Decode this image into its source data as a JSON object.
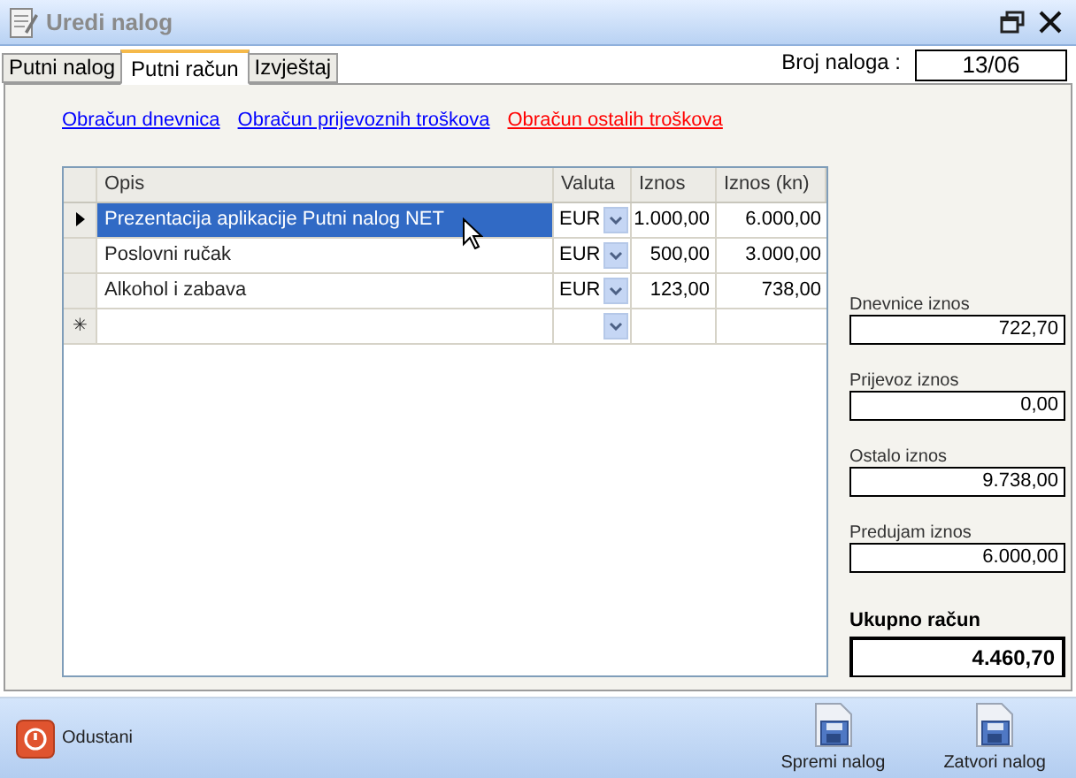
{
  "window": {
    "title": "Uredi nalog"
  },
  "tabs": [
    {
      "label": "Putni nalog",
      "selected": false
    },
    {
      "label": "Putni račun",
      "selected": true
    },
    {
      "label": "Izvještaj",
      "selected": false
    }
  ],
  "order_number": {
    "label": "Broj naloga :",
    "value": "13/06"
  },
  "links": [
    {
      "label": "Obračun dnevnica",
      "color": "#0000ff"
    },
    {
      "label": "Obračun prijevoznih troškova",
      "color": "#0000ff"
    },
    {
      "label": "Obračun ostalih troškova",
      "color": "#ff0000"
    }
  ],
  "table": {
    "columns": [
      "Opis",
      "Valuta",
      "Iznos",
      "Iznos (kn)"
    ],
    "rows": [
      {
        "opis": "Prezentacija aplikacije Putni nalog NET",
        "valuta": "EUR",
        "iznos": "1.000,00",
        "iznos_kn": "6.000,00",
        "selected": true
      },
      {
        "opis": "Poslovni ručak",
        "valuta": "EUR",
        "iznos": "500,00",
        "iznos_kn": "3.000,00",
        "selected": false
      },
      {
        "opis": "Alkohol i zabava",
        "valuta": "EUR",
        "iznos": "123,00",
        "iznos_kn": "738,00",
        "selected": false
      }
    ],
    "new_row_marker": "✳"
  },
  "totals": [
    {
      "kind": "normal",
      "label": "Dnevnice iznos",
      "value": "722,70"
    },
    {
      "kind": "normal",
      "label": "Prijevoz iznos",
      "value": "0,00"
    },
    {
      "kind": "normal",
      "label": "Ostalo iznos",
      "value": "9.738,00"
    },
    {
      "kind": "normal",
      "label": "Predujam iznos",
      "value": "6.000,00"
    },
    {
      "kind": "total",
      "label": "Ukupno račun",
      "value": "4.460,70"
    }
  ],
  "bottom_buttons": [
    {
      "kind": "cancel",
      "label": "Odustani"
    },
    {
      "kind": "save",
      "label": "Spremi nalog"
    },
    {
      "kind": "close",
      "label": "Zatvori nalog"
    }
  ]
}
